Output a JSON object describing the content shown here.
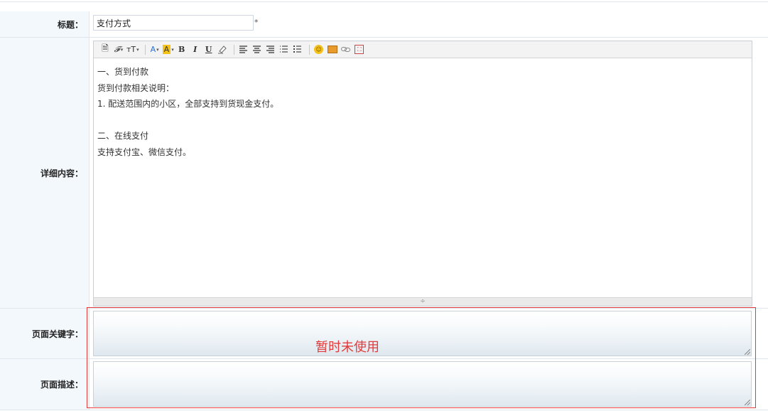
{
  "fields": {
    "title_label": "标题：",
    "title_value": "支付方式",
    "required_mark": "*",
    "content_label": "详细内容：",
    "keywords_label": "页面关键字：",
    "description_label": "页面描述："
  },
  "editor": {
    "toolbar": {
      "font_family": "𝓕",
      "font_size": "ᴛT",
      "font_color": "A",
      "bg_color": "A",
      "bold": "B",
      "italic": "I",
      "underline": "U",
      "dropdown_caret": "▾",
      "emotion": "☺",
      "fullscreen": "⛶"
    },
    "lines": [
      "一、货到付款",
      "货到付款相关说明：",
      "1. 配送范围内的小区，全部支持到货现金支付。",
      "",
      "二、在线支付",
      "支持支付宝、微信支付。"
    ],
    "resize_glyph": "÷"
  },
  "annotation": {
    "text": "暂时未使用",
    "color": "#e23b3b"
  }
}
